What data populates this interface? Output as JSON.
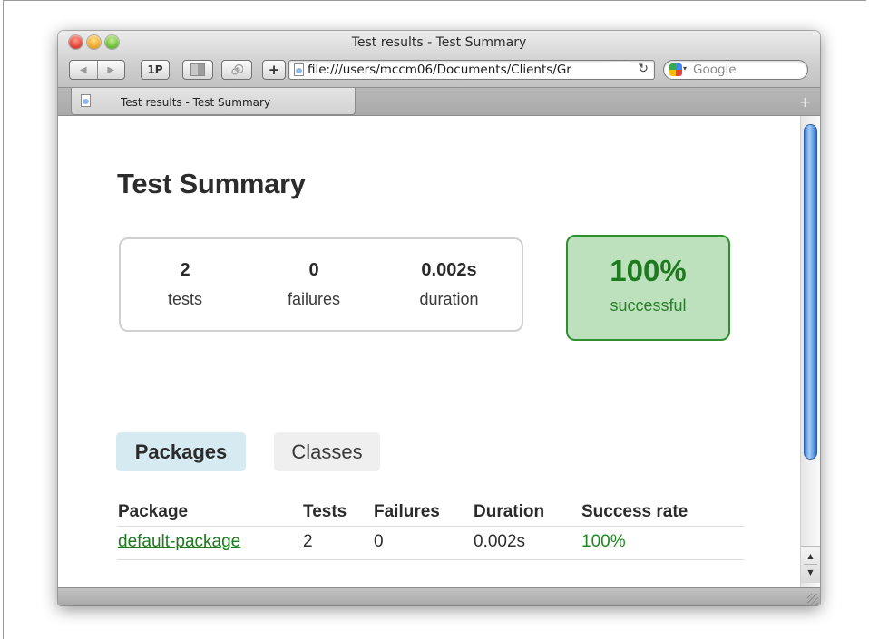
{
  "window": {
    "title": "Test results - Test Summary"
  },
  "toolbar": {
    "back_icon": "◀",
    "forward_icon": "▶",
    "onepassword_label": "1P",
    "history_icon": "spiral",
    "add_label": "+",
    "address_url": "file:///users/mccm06/Documents/Clients/Gr",
    "reload_icon": "↻",
    "search_placeholder": "Google"
  },
  "tabs": {
    "active_label": "Test results - Test Summary",
    "new_tab_label": "+"
  },
  "page": {
    "title": "Test Summary",
    "summary": {
      "tests_value": "2",
      "tests_label": "tests",
      "failures_value": "0",
      "failures_label": "failures",
      "duration_value": "0.002s",
      "duration_label": "duration"
    },
    "success": {
      "value": "100%",
      "label": "successful"
    },
    "view_tabs": {
      "packages": "Packages",
      "classes": "Classes"
    },
    "table": {
      "headers": [
        "Package",
        "Tests",
        "Failures",
        "Duration",
        "Success rate"
      ],
      "rows": [
        [
          "default-package",
          "2",
          "0",
          "0.002s",
          "100%"
        ]
      ]
    }
  },
  "scrollbar": {
    "up_arrow": "▲",
    "down_arrow": "▼"
  },
  "colors": {
    "success_green": "#1f7a1f",
    "success_bg": "#bde0bd",
    "packages_tab_bg": "#d6eaf2",
    "scroll_thumb": "#4a8ae0"
  }
}
